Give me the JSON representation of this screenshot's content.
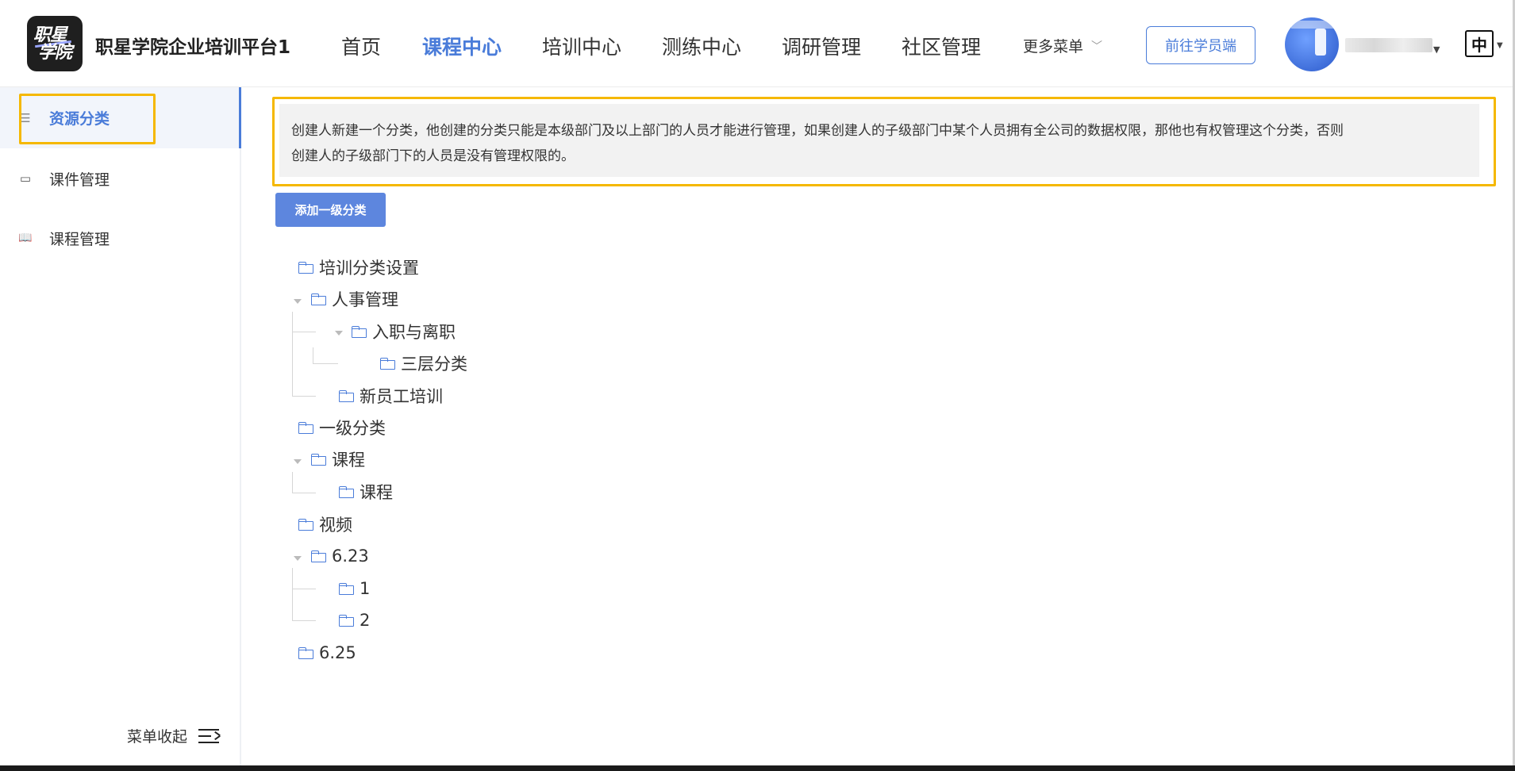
{
  "brand": {
    "logo_line1": "职星",
    "logo_line2": "学院",
    "title": "职星学院企业培训平台1"
  },
  "nav": {
    "items": [
      {
        "label": "首页",
        "active": false
      },
      {
        "label": "课程中心",
        "active": true
      },
      {
        "label": "培训中心",
        "active": false
      },
      {
        "label": "测练中心",
        "active": false
      },
      {
        "label": "调研管理",
        "active": false
      },
      {
        "label": "社区管理",
        "active": false
      }
    ],
    "more_label": "更多菜单",
    "more_icon": "chevron-down-icon",
    "student_button": "前往学员端",
    "language": "中"
  },
  "sidebar": {
    "items": [
      {
        "label": "资源分类",
        "icon": "list-icon",
        "glyph": "☰",
        "active": true
      },
      {
        "label": "课件管理",
        "icon": "courseware-icon",
        "glyph": "▭",
        "active": false
      },
      {
        "label": "课程管理",
        "icon": "book-icon",
        "glyph": "📖",
        "active": false
      }
    ],
    "collapse_label": "菜单收起"
  },
  "main": {
    "notice_line1": "创建人新建一个分类，他创建的分类只能是本级部门及以上部门的人员才能进行管理，如果创建人的子级部门中某个人员拥有全公司的数据权限，那他也有权管理这个分类，否则",
    "notice_line2": "创建人的子级部门下的人员是没有管理权限的。",
    "add_button": "添加一级分类"
  },
  "tree": [
    {
      "label": "培训分类设置"
    },
    {
      "label": "人事管理",
      "expanded": true
    },
    {
      "label": "入职与离职",
      "expanded": true
    },
    {
      "label": "三层分类"
    },
    {
      "label": "新员工培训"
    },
    {
      "label": "一级分类"
    },
    {
      "label": "课程",
      "expanded": true
    },
    {
      "label": "课程"
    },
    {
      "label": "视频"
    },
    {
      "label": "6.23",
      "expanded": true
    },
    {
      "label": "1"
    },
    {
      "label": "2"
    },
    {
      "label": "6.25"
    }
  ],
  "colors": {
    "accent": "#4a7cd9",
    "highlight": "#f5b800",
    "button": "#5d86de"
  }
}
